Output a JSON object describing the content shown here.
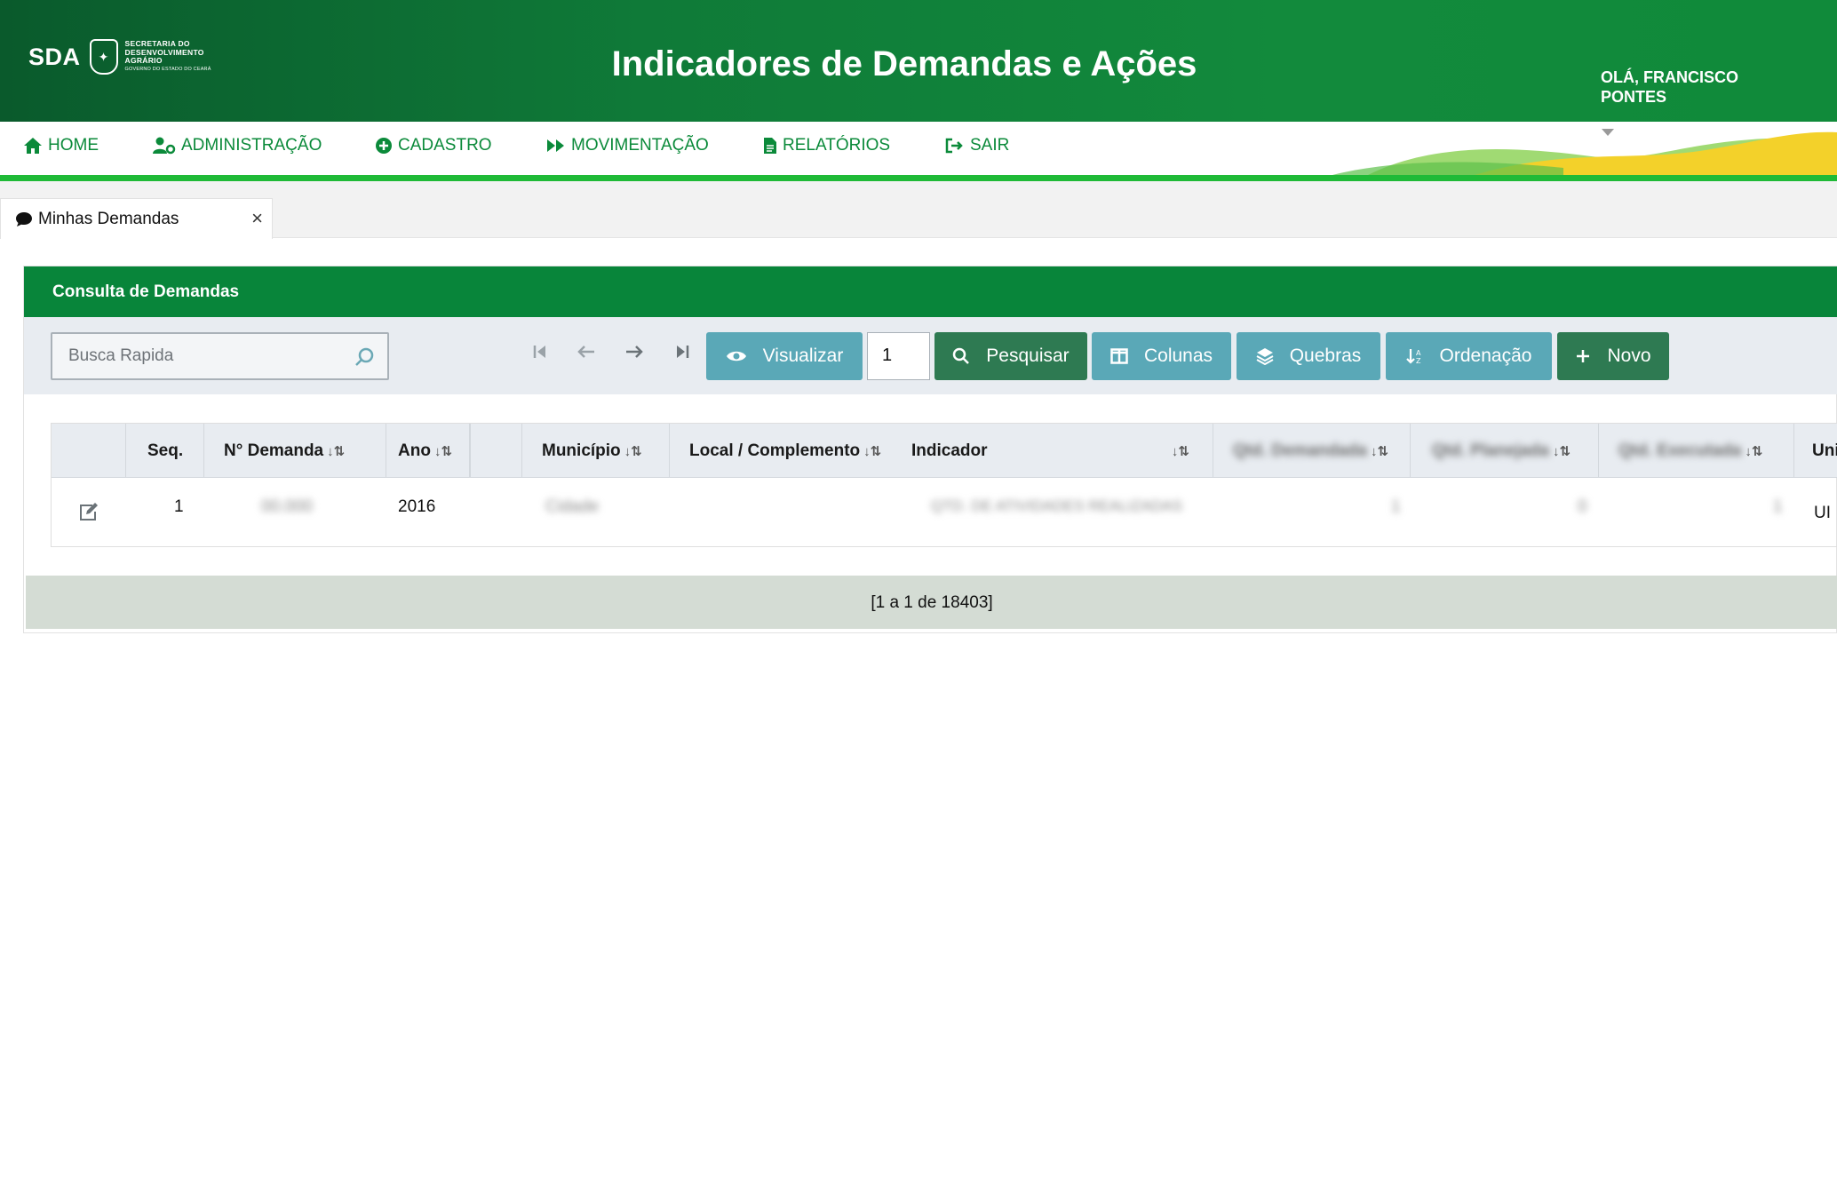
{
  "header": {
    "logo_abbr": "SDA",
    "logo_lines": [
      "SECRETARIA DO",
      "DESENVOLVIMENTO",
      "AGRÁRIO"
    ],
    "logo_subline": "GOVERNO DO ESTADO DO CEARÁ",
    "title": "Indicadores de Demandas e Ações",
    "greeting": "OLÁ, FRANCISCO PONTES"
  },
  "nav": {
    "items": [
      {
        "label": "HOME",
        "icon": "home-icon"
      },
      {
        "label": "ADMINISTRAÇÃO",
        "icon": "user-cog-icon"
      },
      {
        "label": "CADASTRO",
        "icon": "plus-circle-icon"
      },
      {
        "label": "MOVIMENTAÇÃO",
        "icon": "fast-forward-icon"
      },
      {
        "label": "RELATÓRIOS",
        "icon": "file-icon"
      },
      {
        "label": "SAIR",
        "icon": "sign-out-icon"
      }
    ]
  },
  "tabs": [
    {
      "label": "Minhas Demandas",
      "close": "×",
      "icon": "comment-icon"
    }
  ],
  "panel": {
    "title": "Consulta de Demandas",
    "search": {
      "placeholder": "Busca Rapida"
    },
    "page_value": "1",
    "buttons": {
      "visualizar": "Visualizar",
      "pesquisar": "Pesquisar",
      "colunas": "Colunas",
      "quebras": "Quebras",
      "ordenacao": "Ordenação",
      "novo": "Novo"
    },
    "table": {
      "headers": [
        "Seq.",
        "N° Demanda",
        "Ano",
        "Município",
        "Local / Complemento",
        "Indicador",
        "Qtd. Demandada",
        "Qtd. Planejada",
        "Qtd. Executada",
        "Unida"
      ],
      "rows": [
        {
          "seq": "1",
          "demanda": "00.000",
          "ano": "2016",
          "municipio": "Cidade",
          "local": "",
          "indicador": "QTD. DE ATIVIDADES REALIZADAS",
          "qtd_demandada": "1",
          "qtd_planejada": "0",
          "qtd_executada": "1",
          "unidade": "UI"
        }
      ]
    },
    "pagination_text": "[1 a 1 de 18403]"
  },
  "colors": {
    "brand_green": "#08853a",
    "nav_green": "#0b8a3a",
    "teal_button": "#5aa8b7",
    "dark_button": "#2e7a52"
  }
}
